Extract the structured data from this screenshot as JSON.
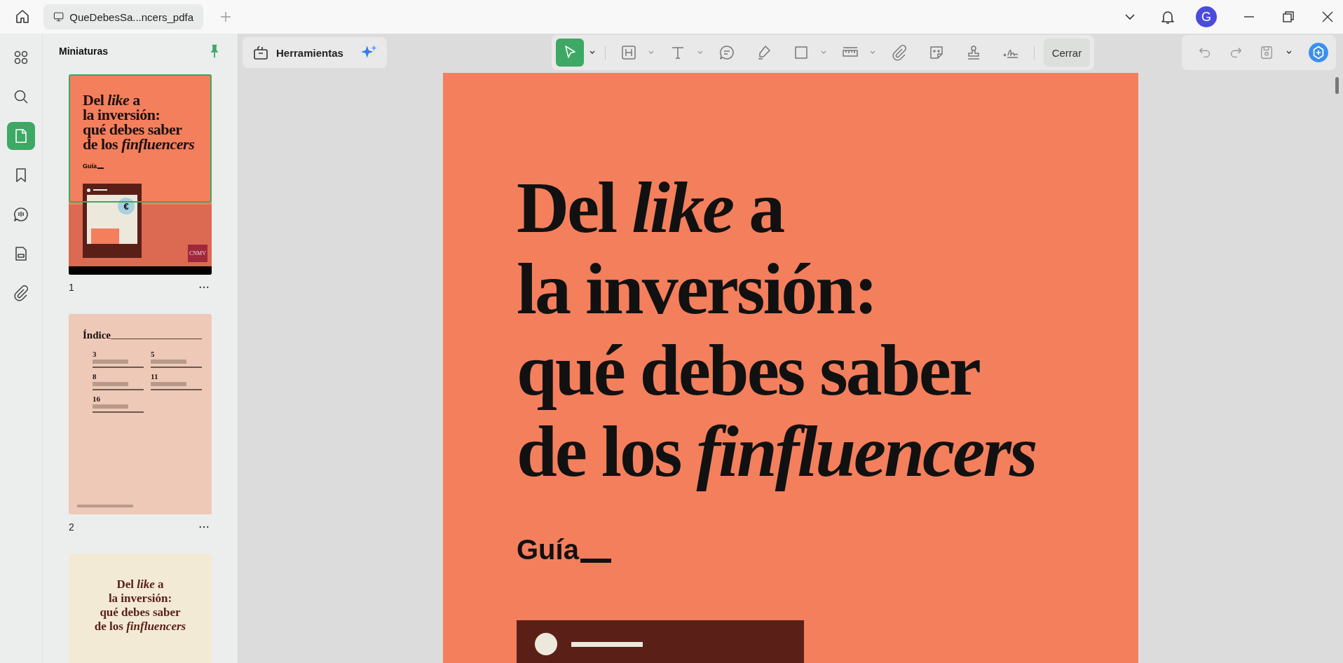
{
  "tab": {
    "title": "QueDebesSa...ncers_pdfa"
  },
  "avatar": {
    "letter": "G"
  },
  "rail": [
    {
      "kind": "grid",
      "selected": false
    },
    {
      "kind": "search",
      "selected": false
    },
    {
      "kind": "page",
      "selected": true
    },
    {
      "kind": "bookmark",
      "selected": false
    },
    {
      "kind": "comment",
      "selected": false
    },
    {
      "kind": "form",
      "selected": false
    },
    {
      "kind": "attachment",
      "selected": false
    }
  ],
  "panel": {
    "title": "Miniaturas"
  },
  "thumbnails": [
    {
      "kind": "cover",
      "label": "1",
      "selected": true,
      "title_lines": [
        "Del *like* a",
        "la inversión:",
        "qué debes saber",
        "de los *finfluencers*"
      ],
      "subtitle": "Guía",
      "badge": "€",
      "logo": "CNMV"
    },
    {
      "kind": "index",
      "label": "2",
      "selected": false,
      "heading": "Índice",
      "entries": [
        "3",
        "5",
        "8",
        "11",
        "16"
      ]
    },
    {
      "kind": "cover_light",
      "selected": false,
      "title_lines": [
        "Del *like* a",
        "la inversión:",
        "qué debes saber",
        "de los *finfluencers*"
      ]
    }
  ],
  "tools_button": {
    "label": "Herramientas"
  },
  "toolbar": [
    {
      "kind": "select",
      "selected": true,
      "caret": true
    },
    {
      "kind": "heading",
      "selected": false,
      "caret": true
    },
    {
      "kind": "text",
      "selected": false,
      "caret": true
    },
    {
      "kind": "comment",
      "selected": false,
      "caret": false
    },
    {
      "kind": "highlighter",
      "selected": false,
      "caret": false
    },
    {
      "kind": "rectangle",
      "selected": false,
      "caret": true
    },
    {
      "kind": "ruler",
      "selected": false,
      "caret": true
    },
    {
      "kind": "attachment",
      "selected": false,
      "caret": false
    },
    {
      "kind": "sticker",
      "selected": false,
      "caret": false
    },
    {
      "kind": "stamp",
      "selected": false,
      "caret": false
    },
    {
      "kind": "signature",
      "selected": false,
      "caret": false
    }
  ],
  "close_button": {
    "label": "Cerrar"
  },
  "page": {
    "title_lines": [
      "Del *like* a",
      "la inversión:",
      "qué debes saber",
      "de los *finfluencers*"
    ],
    "subtitle": "Guía"
  }
}
